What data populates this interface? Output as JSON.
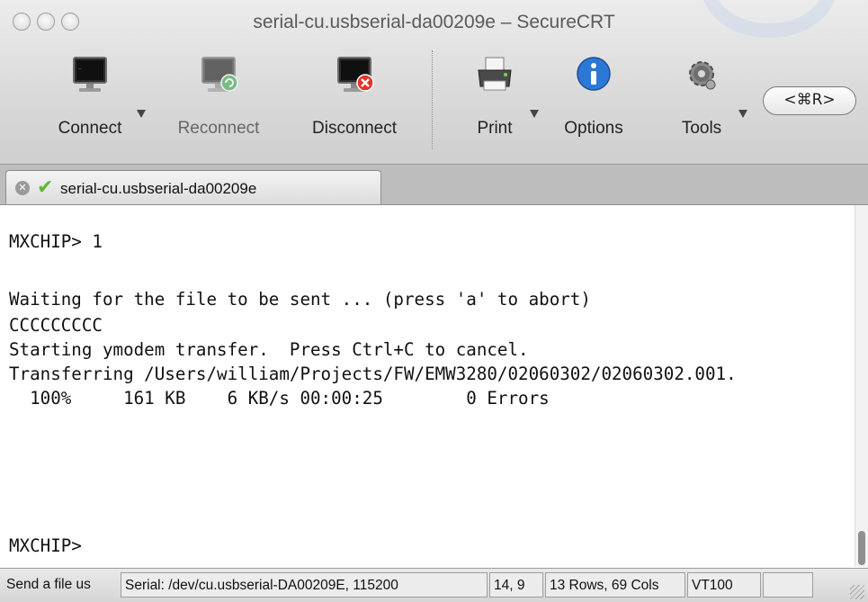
{
  "window": {
    "title": "serial-cu.usbserial-da00209e – SecureCRT"
  },
  "toolbar": {
    "connect_label": "Connect",
    "reconnect_label": "Reconnect",
    "disconnect_label": "Disconnect",
    "print_label": "Print",
    "options_label": "Options",
    "tools_label": "Tools",
    "shortcut_label": "<⌘R>"
  },
  "tabs": [
    {
      "label": "serial-cu.usbserial-da00209e",
      "status": "connected",
      "status_icon": "checkmark-icon"
    }
  ],
  "terminal": {
    "lines": [
      "MXCHIP> 1",
      "",
      "Waiting for the file to be sent ... (press 'a' to abort)",
      "CCCCCCCCC",
      "Starting ymodem transfer.  Press Ctrl+C to cancel.",
      "Transferring /Users/william/Projects/FW/EMW3280/02060302/02060302.001.",
      "  100%     161 KB    6 KB/s 00:00:25        0 Errors",
      "",
      "",
      "",
      "",
      "MXCHIP>"
    ]
  },
  "statusbar": {
    "message": "Send a file us",
    "connection": "Serial: /dev/cu.usbserial-DA00209E, 115200",
    "cursor": "14, 9",
    "size": "13 Rows, 69 Cols",
    "emulation": "VT100",
    "extra": ""
  },
  "colors": {
    "accent_green": "#5fb53a",
    "disconnect_red": "#e2332b",
    "reconnect_green": "#3aa84a",
    "options_blue": "#2c78d6"
  }
}
